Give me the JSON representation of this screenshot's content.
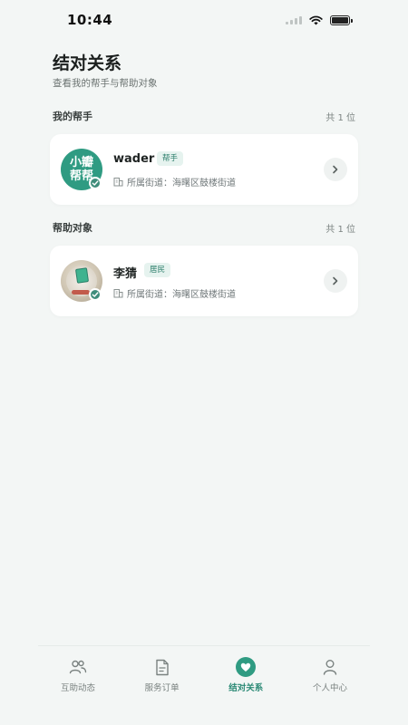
{
  "status_bar": {
    "time": "10:44"
  },
  "page": {
    "title": "结对关系",
    "subtitle": "查看我的帮手与帮助对象"
  },
  "sections": [
    {
      "title": "我的帮手",
      "count": "共 1 位",
      "card": {
        "name": "wader",
        "tag": "帮手",
        "street": "所属街道：海曙区鼓楼街道",
        "avatar_text": [
          "小瓣",
          "帮帮"
        ]
      }
    },
    {
      "title": "帮助对象",
      "count": "共 1 位",
      "card": {
        "name": "李猜",
        "tag": "居民",
        "street": "所属街道：海曙区鼓楼街道"
      }
    }
  ],
  "tabbar": {
    "tabs": [
      {
        "label": "互助动态",
        "icon": "users-icon",
        "active": false
      },
      {
        "label": "服务订单",
        "icon": "document-icon",
        "active": false
      },
      {
        "label": "结对关系",
        "icon": "heart-icon",
        "active": true
      },
      {
        "label": "个人中心",
        "icon": "person-icon",
        "active": false
      }
    ]
  },
  "colors": {
    "accent": "#2f9b82",
    "background": "#f3f6f5",
    "tag_bg": "#e6f3ef"
  }
}
